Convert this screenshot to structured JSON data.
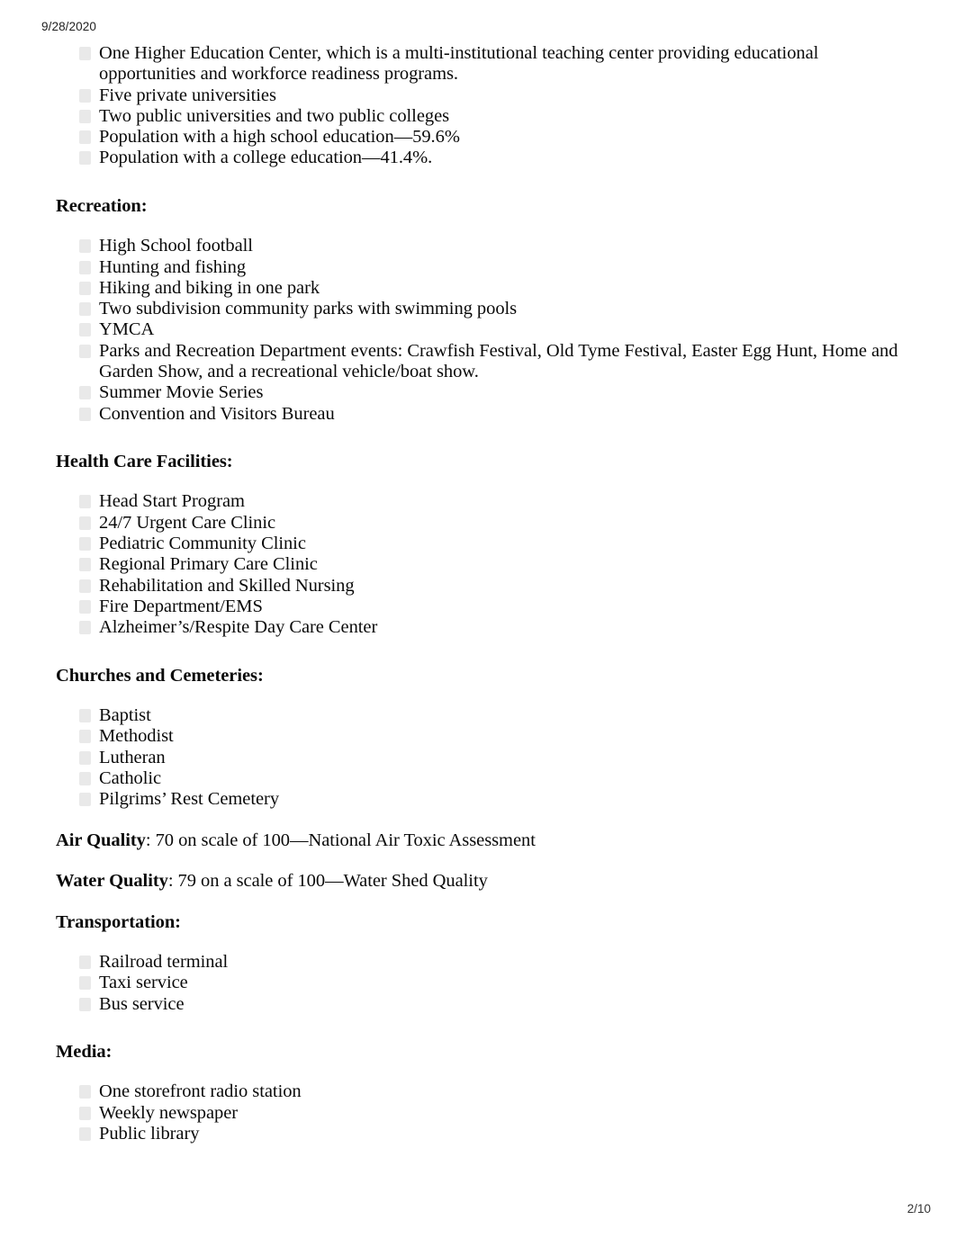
{
  "header": {
    "date": "9/28/2020"
  },
  "footer": {
    "page_number": "2/10"
  },
  "bullet_icon_name": "square-bullet-icon",
  "content": {
    "education_list": {
      "items": [
        "One Higher Education Center, which is a multi-institutional teaching center providing educational opportunities and workforce readiness programs.",
        "Five private universities",
        "Two public universities and two public colleges",
        "Population with a high school education—59.6%",
        "Population with a college education—41.4%."
      ]
    },
    "recreation": {
      "heading": "Recreation:",
      "items": [
        "High School football",
        "Hunting and fishing",
        "Hiking and biking in one park",
        "Two subdivision community parks with swimming pools",
        "YMCA",
        "Parks and Recreation Department events: Crawfish Festival, Old Tyme Festival, Easter Egg Hunt, Home and Garden Show, and a recreational vehicle/boat show.",
        "Summer Movie Series",
        "Convention and Visitors Bureau"
      ]
    },
    "health_care": {
      "heading": "Health Care Facilities:",
      "items": [
        "Head Start Program",
        "24/7 Urgent Care Clinic",
        "Pediatric Community Clinic",
        "Regional Primary Care Clinic",
        "Rehabilitation and Skilled Nursing",
        "Fire Department/EMS",
        "Alzheimer’s/Respite Day Care Center"
      ]
    },
    "churches": {
      "heading": "Churches and Cemeteries:",
      "items": [
        "Baptist",
        "Methodist",
        "Lutheran",
        "Catholic",
        "Pilgrims’ Rest Cemetery"
      ]
    },
    "air_quality": {
      "label": "Air Quality",
      "value": ": 70 on scale of 100—National Air Toxic Assessment"
    },
    "water_quality": {
      "label": "Water Quality",
      "value": ": 79 on a scale of 100—Water Shed Quality"
    },
    "transportation": {
      "heading": "Transportation:",
      "items": [
        "Railroad terminal",
        "Taxi service",
        "Bus service"
      ]
    },
    "media": {
      "heading": "Media:",
      "items": [
        "One storefront radio station",
        "Weekly newspaper",
        "Public library"
      ]
    }
  }
}
